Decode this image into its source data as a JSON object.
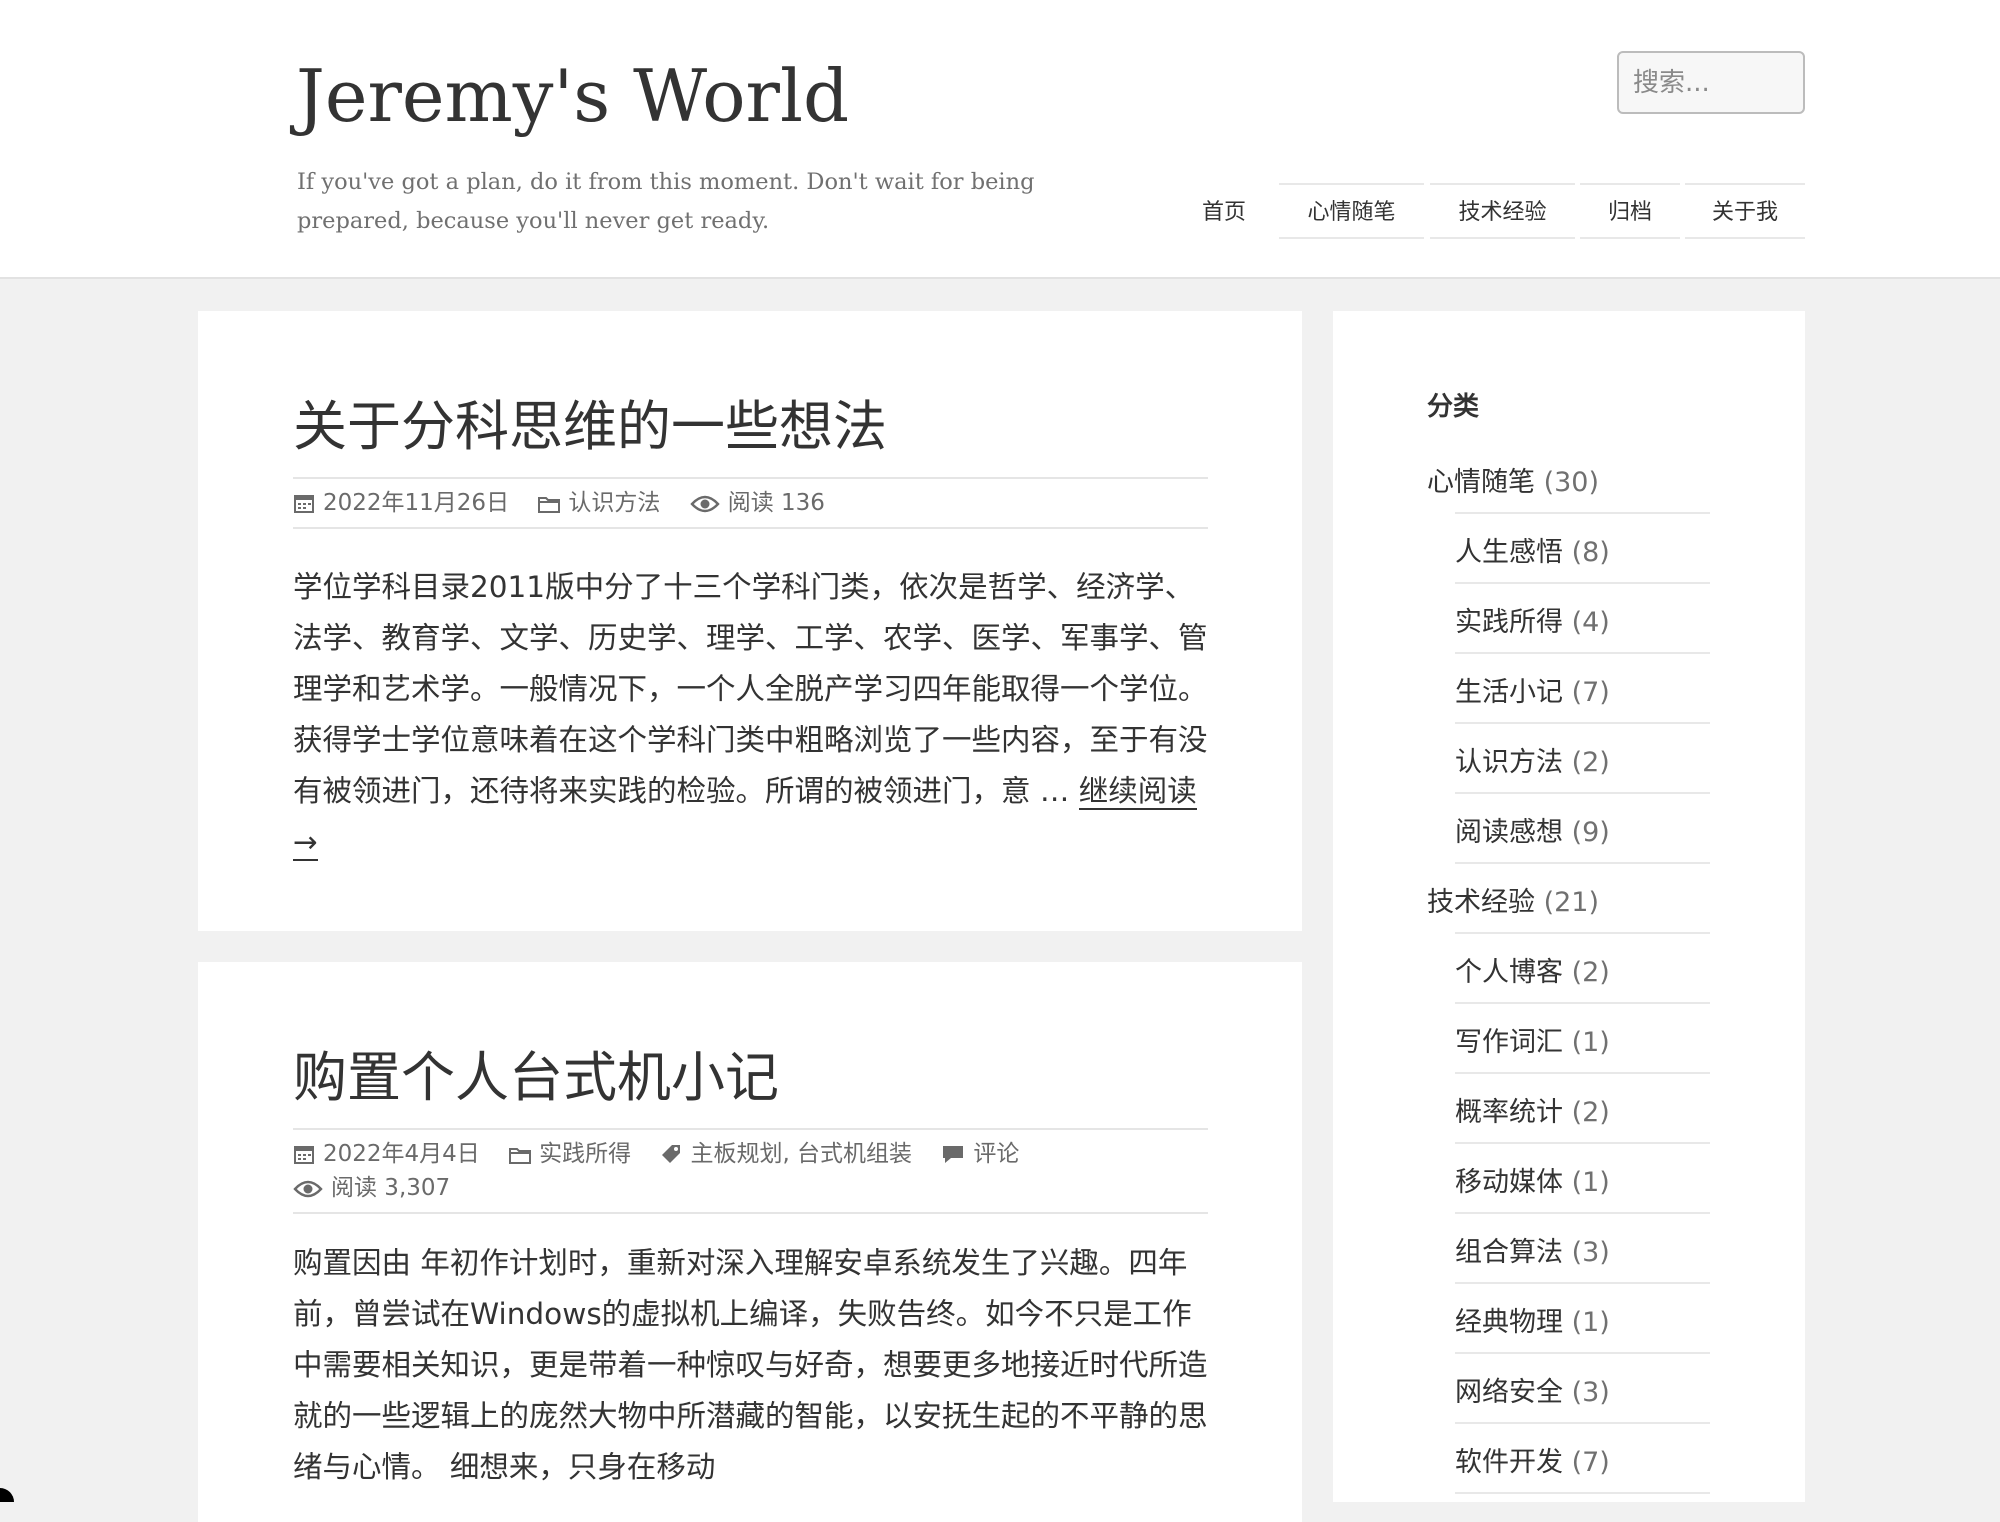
{
  "site": {
    "title": "Jeremy's World",
    "tagline": "If you've got a plan, do it from this moment. Don't wait for being prepared, because you'll never get ready."
  },
  "search": {
    "placeholder": "搜索..."
  },
  "nav": [
    "首页",
    "心情随笔",
    "技术经验",
    "归档",
    "关于我"
  ],
  "posts": [
    {
      "title": "关于分科思维的一些想法",
      "date": "2022年11月26日",
      "category": "认识方法",
      "views": "阅读 136",
      "excerpt": "学位学科目录2011版中分了十三个学科门类，依次是哲学、经济学、法学、教育学、文学、历史学、理学、工学、农学、医学、军事学、管理学和艺术学。一般情况下，一个人全脱产学习四年能取得一个学位。获得学士学位意味着在这个学科门类中粗略浏览了一些内容，至于有没有被领进门，还待将来实践的检验。所谓的被领进门，意 … ",
      "read_more": "继续阅读 →"
    },
    {
      "title": "购置个人台式机小记",
      "date": "2022年4月4日",
      "category": "实践所得",
      "tags": "主板规划, 台式机组装",
      "comments": "评论",
      "views": "阅读 3,307",
      "excerpt": "购置因由 年初作计划时，重新对深入理解安卓系统发生了兴趣。四年前，曾尝试在Windows的虚拟机上编译，失败告终。如今不只是工作中需要相关知识，更是带着一种惊叹与好奇，想要更多地接近时代所造就的一些逻辑上的庞然大物中所潜藏的智能，以安抚生起的不平静的思绪与心情。 细想来，只身在移动"
    }
  ],
  "sidebar": {
    "title": "分类",
    "categories": [
      {
        "name": "心情随笔",
        "count": "(30)",
        "level": 0
      },
      {
        "name": "人生感悟",
        "count": "(8)",
        "level": 1
      },
      {
        "name": "实践所得",
        "count": "(4)",
        "level": 1
      },
      {
        "name": "生活小记",
        "count": "(7)",
        "level": 1
      },
      {
        "name": "认识方法",
        "count": "(2)",
        "level": 1
      },
      {
        "name": "阅读感想",
        "count": "(9)",
        "level": 1
      },
      {
        "name": "技术经验",
        "count": "(21)",
        "level": 0
      },
      {
        "name": "个人博客",
        "count": "(2)",
        "level": 1
      },
      {
        "name": "写作词汇",
        "count": "(1)",
        "level": 1
      },
      {
        "name": "概率统计",
        "count": "(2)",
        "level": 1
      },
      {
        "name": "移动媒体",
        "count": "(1)",
        "level": 1
      },
      {
        "name": "组合算法",
        "count": "(3)",
        "level": 1
      },
      {
        "name": "经典物理",
        "count": "(1)",
        "level": 1
      },
      {
        "name": "网络安全",
        "count": "(3)",
        "level": 1
      },
      {
        "name": "软件开发",
        "count": "(7)",
        "level": 1
      }
    ]
  },
  "icons": [
    "calendar-icon",
    "folder-icon",
    "tag-icon",
    "comment-icon",
    "eye-icon"
  ]
}
